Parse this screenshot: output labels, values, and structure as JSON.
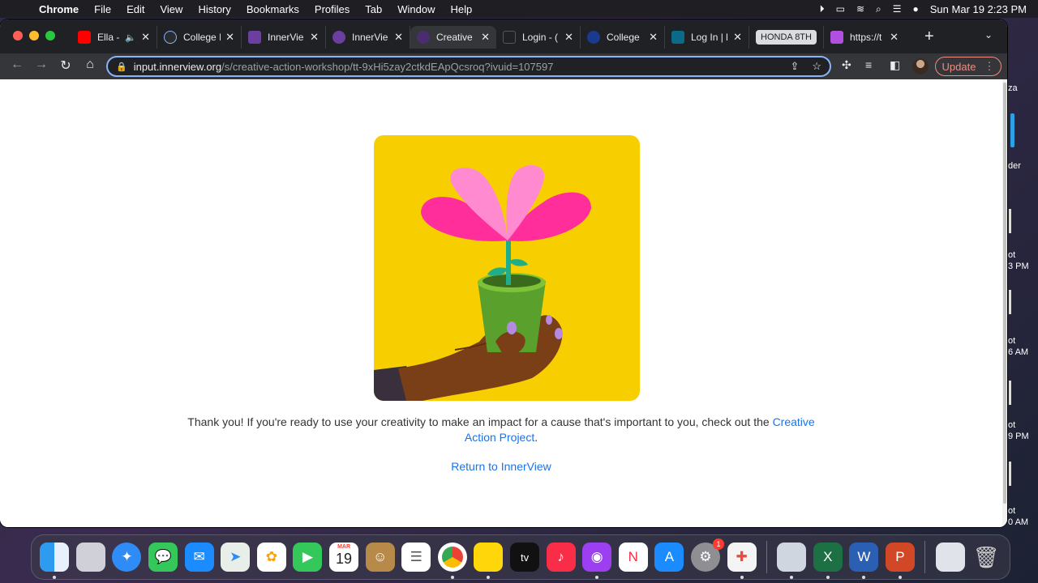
{
  "menubar": {
    "apple": "",
    "app_name": "Chrome",
    "menus": [
      "File",
      "Edit",
      "View",
      "History",
      "Bookmarks",
      "Profiles",
      "Tab",
      "Window",
      "Help"
    ],
    "clock": "Sun Mar 19  2:23 PM"
  },
  "desktop": {
    "right_texts": [
      "za",
      "der",
      "ot",
      "3 PM",
      "ot",
      "6 AM",
      "ot",
      "9 PM",
      "ot",
      "0 AM"
    ]
  },
  "tabs": [
    {
      "title": "Ella -",
      "favicon_color": "#ff0000",
      "icon": "youtube-icon",
      "audio": "🔈"
    },
    {
      "title": "College I",
      "favicon_color": "#2a2b2e",
      "icon": "college-s-icon"
    },
    {
      "title": "InnerVie",
      "favicon_color": "#6b3fa0",
      "icon": "innerview-icon"
    },
    {
      "title": "InnerVie",
      "favicon_color": "#6b3fa0",
      "icon": "innerview-icon"
    },
    {
      "title": "Creative",
      "favicon_color": "#6b3fa0",
      "icon": "innerview-icon",
      "active": true
    },
    {
      "title": "Login - (",
      "favicon_color": "#202124",
      "icon": "login-icon"
    },
    {
      "title": "College",
      "favicon_color": "#1a3a8f",
      "icon": "college-icon"
    },
    {
      "title": "Log In | l",
      "favicon_color": "#0b6a8a",
      "icon": "fsa-icon"
    },
    {
      "title": "HONDA 8TH",
      "group_chip": true
    },
    {
      "title": "https://t",
      "favicon_color": "#b14fe0",
      "icon": "link-icon"
    }
  ],
  "toolbar": {
    "url_host": "input.innerview.org",
    "url_path": "/s/creative-action-workshop/tt-9xHi5zay2ctkdEApQcsroq?ivuid=107597",
    "update_label": "Update"
  },
  "page": {
    "thanks_text": "Thank you! If you're ready to use your creativity to make an impact for a cause that's important to you, check out the ",
    "link_text": "Creative Action Project",
    "period": ".",
    "return_link": "Return to InnerView"
  },
  "colors": {
    "illustration_bg": "#f7cf00",
    "link": "#1a73e8"
  },
  "dock": {
    "calendar_month": "MAR",
    "calendar_day": "19",
    "settings_badge": "1",
    "tv_label": "tv"
  }
}
